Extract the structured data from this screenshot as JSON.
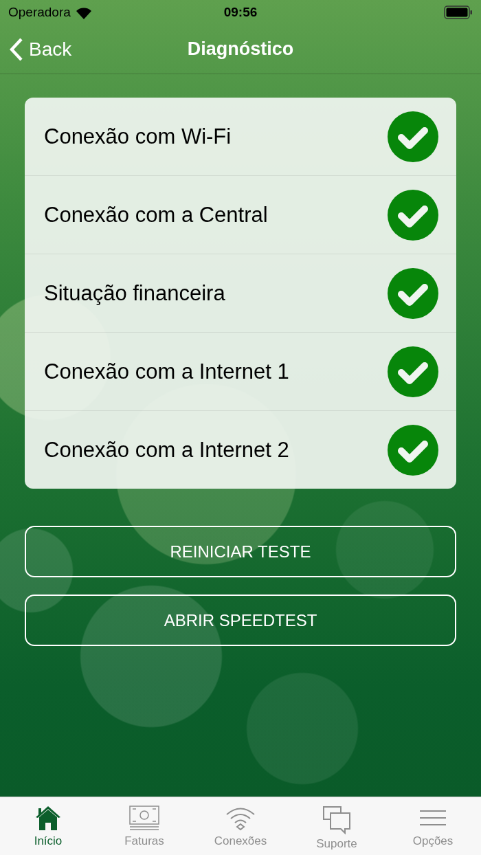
{
  "status_bar": {
    "carrier": "Operadora",
    "time": "09:56"
  },
  "nav": {
    "back": "Back",
    "title": "Diagnóstico"
  },
  "checks": [
    {
      "label": "Conexão com Wi-Fi",
      "passed": true
    },
    {
      "label": "Conexão com a Central",
      "passed": true
    },
    {
      "label": "Situação financeira",
      "passed": true
    },
    {
      "label": "Conexão com a Internet 1",
      "passed": true
    },
    {
      "label": "Conexão com a Internet 2",
      "passed": true
    }
  ],
  "buttons": [
    "REINICIAR TESTE",
    "ABRIR SPEEDTEST"
  ],
  "tabs": [
    {
      "label": "Início",
      "kind": "home",
      "selected": true
    },
    {
      "label": "Faturas",
      "kind": "bill",
      "selected": false
    },
    {
      "label": "Conexões",
      "kind": "wifi",
      "selected": false
    },
    {
      "label": "Suporte",
      "kind": "chat",
      "selected": false
    },
    {
      "label": "Opções",
      "kind": "menu",
      "selected": false
    }
  ]
}
